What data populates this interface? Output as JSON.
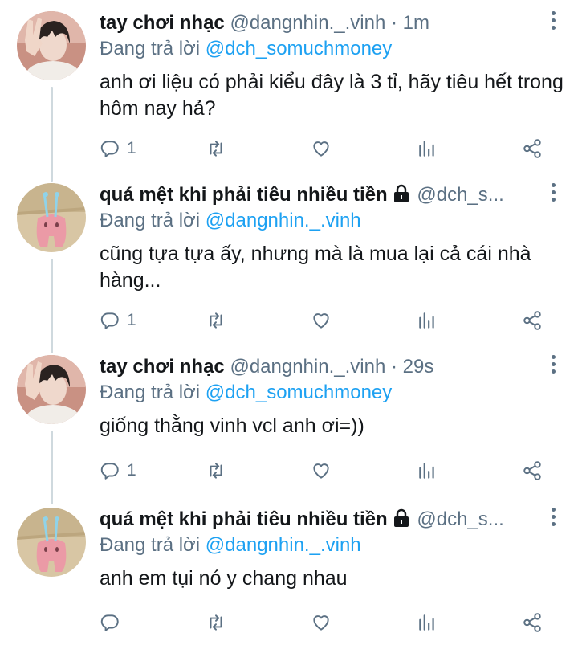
{
  "tweets": [
    {
      "name": "tay chơi nhạc",
      "handle": "@dangnhin._.vinh",
      "separator": "·",
      "time": "1m",
      "reply_prefix": "Đang trả lời",
      "reply_to": "@dch_somuchmoney",
      "text": "anh ơi liệu có phải kiểu đây là 3 tỉ, hãy tiêu hết trong hôm nay hả?",
      "reply_count": "1",
      "locked": false
    },
    {
      "name": "quá mệt khi phải tiêu nhiều tiền",
      "handle": "@dch_s...",
      "reply_prefix": "Đang trả lời",
      "reply_to": "@dangnhin._.vinh",
      "text": "cũng tựa tựa ấy, nhưng mà là mua lại cả cái nhà hàng...",
      "reply_count": "1",
      "locked": true
    },
    {
      "name": "tay chơi nhạc",
      "handle": "@dangnhin._.vinh",
      "separator": "·",
      "time": "29s",
      "reply_prefix": "Đang trả lời",
      "reply_to": "@dch_somuchmoney",
      "text": "giống thằng vinh vcl anh ơi=))",
      "reply_count": "1",
      "locked": false
    },
    {
      "name": "quá mệt khi phải tiêu nhiều tiền",
      "handle": "@dch_s...",
      "reply_prefix": "Đang trả lời",
      "reply_to": "@dangnhin._.vinh",
      "text": "anh em tụi nó y chang nhau",
      "reply_count": "",
      "locked": true
    }
  ],
  "icons": {
    "reply": "reply-icon",
    "retweet": "retweet-icon",
    "like": "heart-icon",
    "analytics": "analytics-icon",
    "share": "share-icon",
    "more": "more-icon",
    "lock": "lock-icon"
  },
  "colors": {
    "text": "#14171a",
    "secondary": "#5b7083",
    "link": "#1da1f2",
    "thread_line": "#cfd9de"
  }
}
